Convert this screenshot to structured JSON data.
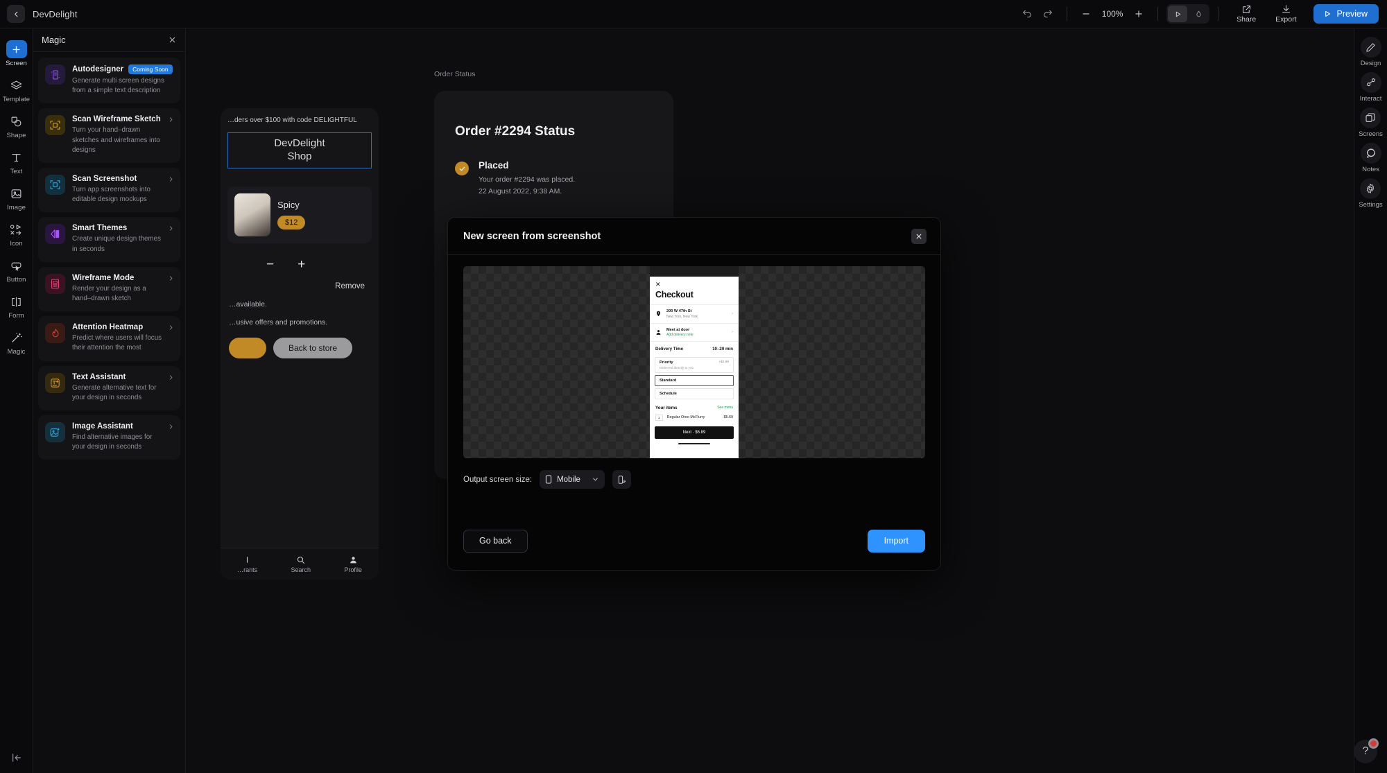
{
  "topbar": {
    "project_title": "DevDelight",
    "back_icon": "chevron-left-icon",
    "undo_icon": "undo-icon",
    "redo_icon": "redo-icon",
    "zoom_out_label": "−",
    "zoom_value": "100%",
    "zoom_in_label": "+",
    "mode_play_icon": "play-icon",
    "mode_hand_icon": "hand-icon",
    "share_label": "Share",
    "export_label": "Export",
    "preview_label": "Preview",
    "preview_color": "#1f6fd0"
  },
  "left_rail": {
    "items": [
      {
        "label": "Screen",
        "icon": "plus-icon",
        "active": true
      },
      {
        "label": "Template",
        "icon": "layers-icon",
        "active": false
      },
      {
        "label": "Shape",
        "icon": "shapes-icon",
        "active": false
      },
      {
        "label": "Text",
        "icon": "text-icon",
        "active": false
      },
      {
        "label": "Image",
        "icon": "image-icon",
        "active": false
      },
      {
        "label": "Icon",
        "icon": "icons-grid-icon",
        "active": false
      },
      {
        "label": "Button",
        "icon": "button-icon",
        "active": false
      },
      {
        "label": "Form",
        "icon": "form-icon",
        "active": false
      },
      {
        "label": "Magic",
        "icon": "magic-wand-icon",
        "active": false
      }
    ],
    "bottom_icon": "collapse-left-icon"
  },
  "magic_panel": {
    "title": "Magic",
    "close_icon": "close-icon",
    "items": [
      {
        "title": "Autodesigner",
        "badge": "Coming Soon",
        "desc": "Generate multi screen designs from a simple text description",
        "icon": "autodesigner-icon",
        "icon_color": "#9b5cf0",
        "icon_bg": "#241a3c"
      },
      {
        "title": "Scan Wireframe Sketch",
        "badge": "",
        "desc": "Turn your hand–drawn sketches and wireframes into designs",
        "icon": "scan-wireframe-icon",
        "icon_color": "#d3a01e",
        "icon_bg": "#3a2f0d"
      },
      {
        "title": "Scan Screenshot",
        "badge": "",
        "desc": "Turn app screenshots into editable design mockups",
        "icon": "scan-screenshot-icon",
        "icon_color": "#2ba8e0",
        "icon_bg": "#12303e"
      },
      {
        "title": "Smart Themes",
        "badge": "",
        "desc": "Create unique design themes in seconds",
        "icon": "smart-themes-icon",
        "icon_color": "#a455ef",
        "icon_bg": "#2a1440"
      },
      {
        "title": "Wireframe Mode",
        "badge": "",
        "desc": "Render your design as a hand–drawn sketch",
        "icon": "wireframe-mode-icon",
        "icon_color": "#e0407a",
        "icon_bg": "#3a1222"
      },
      {
        "title": "Attention Heatmap",
        "badge": "",
        "desc": "Predict where users will focus their attention the most",
        "icon": "flame-icon",
        "icon_color": "#e03c3c",
        "icon_bg": "#3a1a14"
      },
      {
        "title": "Text Assistant",
        "badge": "",
        "desc": "Generate alternative text for your design in seconds",
        "icon": "text-assistant-icon",
        "icon_color": "#d79a23",
        "icon_bg": "#352a10"
      },
      {
        "title": "Image Assistant",
        "badge": "",
        "desc": "Find alternative images for your design in seconds",
        "icon": "image-assistant-icon",
        "icon_color": "#2ba8e0",
        "icon_bg": "#14303c"
      }
    ],
    "chevron_icon": "chevron-right-icon"
  },
  "canvas": {
    "order_status_label": "Order Status",
    "shop_screen": {
      "banner": "…ders over $100 with code DELIGHTFUL",
      "logo_line1": "DevDelight",
      "logo_line2": "Shop",
      "item_name": "Spicy",
      "item_price": "$12",
      "minus": "−",
      "plus": "+",
      "remove_label": "Remove",
      "line1": "…available.",
      "line2": "…usive offers and promotions.",
      "back_label": "Back to store",
      "tabs": [
        {
          "label": "…rants",
          "icon": "list-icon"
        },
        {
          "label": "Search",
          "icon": "search-icon"
        },
        {
          "label": "Profile",
          "icon": "person-icon"
        }
      ]
    },
    "order_screen": {
      "title": "Order #2294 Status",
      "status": "Placed",
      "line1": "Your order #2294 was placed.",
      "line2": "22 August 2022, 9:38 AM.",
      "check_icon": "check-circle-icon",
      "accent": "#c28a27"
    }
  },
  "modal": {
    "title": "New screen from screenshot",
    "close_icon": "close-icon",
    "size_label": "Output screen size:",
    "size_value": "Mobile",
    "size_icon": "mobile-icon",
    "size_chevron": "chevron-down-icon",
    "orientation_icon": "rotate-orientation-icon",
    "go_back_label": "Go back",
    "import_label": "Import",
    "import_color": "#2f93ff",
    "screenshot": {
      "close_icon": "close-x-icon",
      "heading": "Checkout",
      "address_title": "200 W 47th St",
      "address_sub": "New York, New York",
      "delivery_title": "Meet at door",
      "delivery_sub": "Add delivery note",
      "delivery_time_label": "Delivery Time",
      "delivery_time_value": "10–20 min",
      "options": [
        {
          "name": "Priority",
          "desc": "Delivered directly to you",
          "price": "+$2.99",
          "selected": false
        },
        {
          "name": "Standard",
          "desc": "",
          "price": "",
          "selected": true
        },
        {
          "name": "Schedule",
          "desc": "",
          "price": "",
          "selected": false
        }
      ],
      "items_label": "Your items",
      "see_menu_label": "See menu",
      "item_qty": "1",
      "item_name": "Regular Oreo McFlurry",
      "item_price": "$5.69",
      "next_label": "Next · $5.89"
    }
  },
  "right_rail": {
    "items": [
      {
        "label": "Design",
        "icon": "pencil-icon"
      },
      {
        "label": "Interact",
        "icon": "interact-nodes-icon"
      },
      {
        "label": "Screens",
        "icon": "screens-stack-icon"
      },
      {
        "label": "Notes",
        "icon": "comment-icon"
      },
      {
        "label": "Settings",
        "icon": "gear-icon"
      }
    ]
  },
  "help": {
    "icon": "question-mark-icon",
    "badge": ""
  }
}
